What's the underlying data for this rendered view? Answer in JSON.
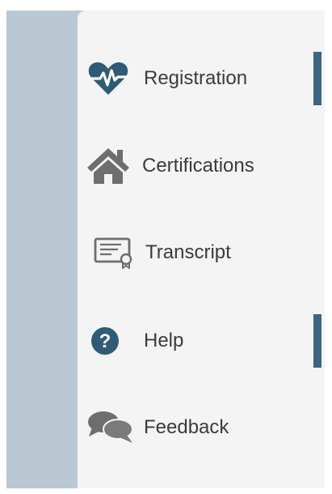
{
  "nav": {
    "items": [
      {
        "label": "Registration",
        "icon": "heart-pulse-icon",
        "active": true
      },
      {
        "label": "Certifications",
        "icon": "home-icon",
        "active": false
      },
      {
        "label": "Transcript",
        "icon": "certificate-icon",
        "active": false
      },
      {
        "label": "Help",
        "icon": "question-circle-icon",
        "active": true
      },
      {
        "label": "Feedback",
        "icon": "comments-icon",
        "active": false
      }
    ]
  },
  "colors": {
    "rail": "#b9c8d2",
    "panel": "#f4f4f4",
    "accent": "#3a6682",
    "icon_dark": "#2f5b77",
    "icon_grey": "#6e6e6e",
    "text": "#3b3b3b"
  }
}
